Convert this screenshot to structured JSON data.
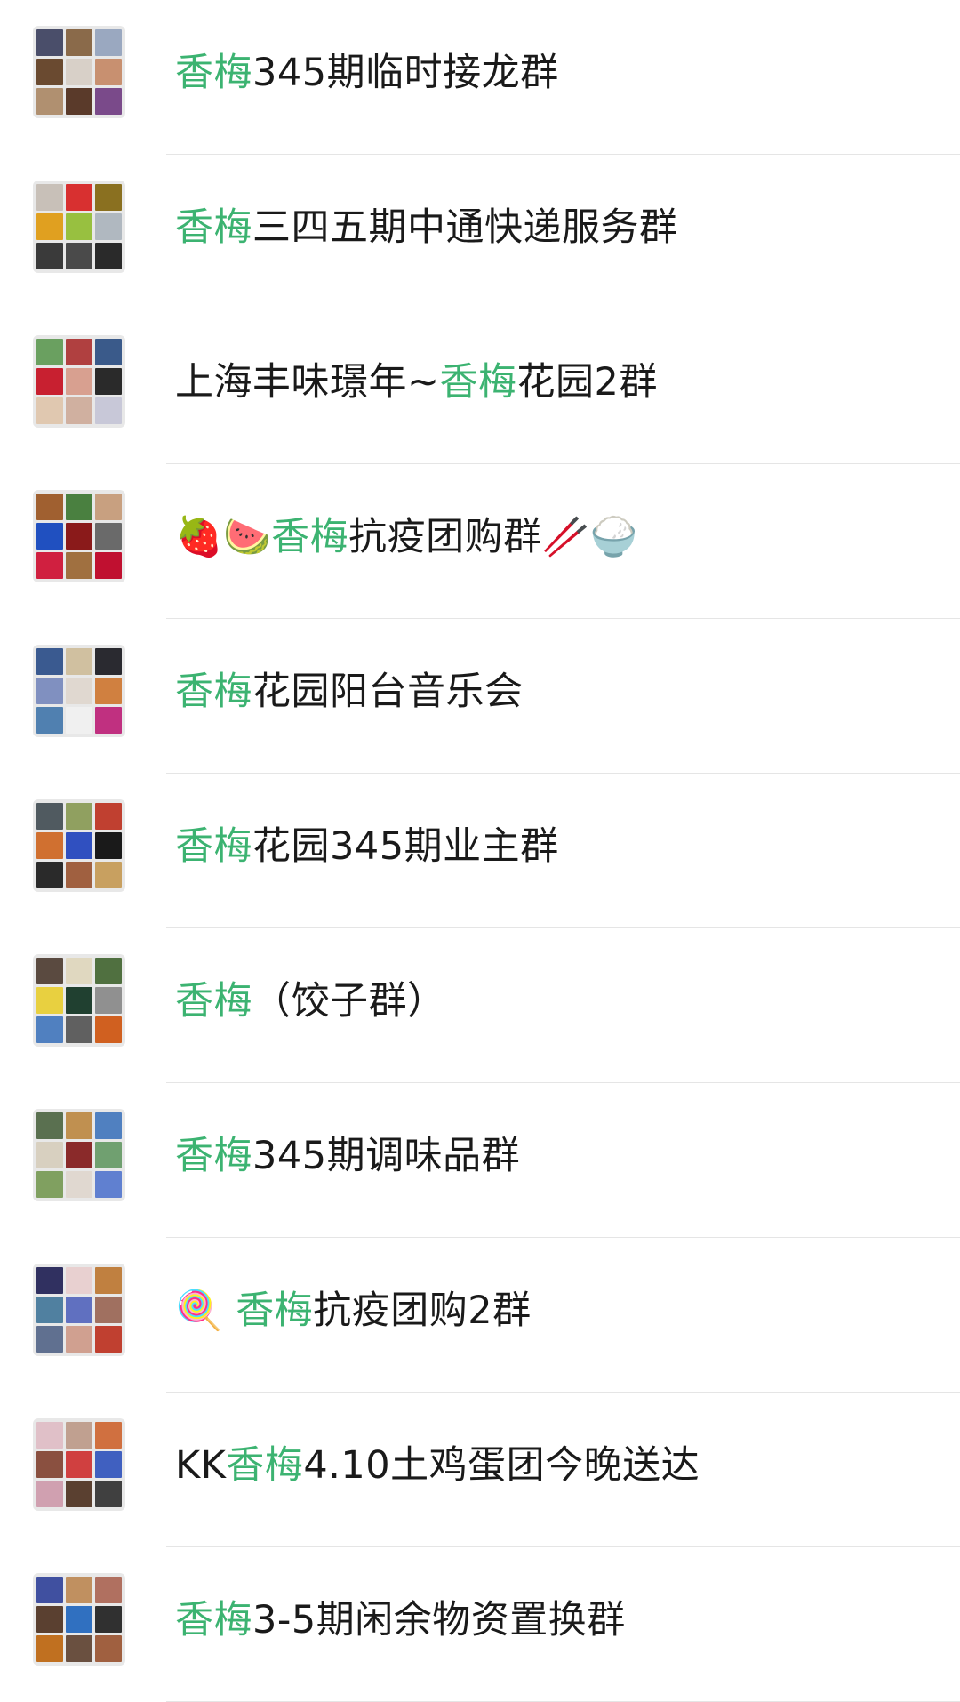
{
  "accent_color": "#3cb371",
  "groups": [
    {
      "parts": [
        {
          "t": "香梅",
          "hl": true
        },
        {
          "t": "345期临时接龙群",
          "hl": false
        }
      ],
      "avatar_colors": [
        "#4a4e6a",
        "#8a6a4a",
        "#9aa8c0",
        "#6a4a30",
        "#d8d0c8",
        "#c89070",
        "#b09070",
        "#5a3a2a",
        "#7a4a8a"
      ]
    },
    {
      "parts": [
        {
          "t": "香梅",
          "hl": true
        },
        {
          "t": "三四五期中通快递服务群",
          "hl": false
        }
      ],
      "avatar_colors": [
        "#c8c0b8",
        "#d83030",
        "#8a7020",
        "#e0a020",
        "#98c040",
        "#b0b8c0",
        "#3a3a3a",
        "#4a4a4a",
        "#2a2a2a"
      ]
    },
    {
      "parts": [
        {
          "t": "上海丰味璟年~",
          "hl": false
        },
        {
          "t": "香梅",
          "hl": true
        },
        {
          "t": "花园2群",
          "hl": false
        }
      ],
      "avatar_colors": [
        "#6aa060",
        "#b04040",
        "#3a5a8a",
        "#c82030",
        "#d8a090",
        "#2a2a2a",
        "#e0c8b0",
        "#d0b0a0",
        "#c8c8d8"
      ]
    },
    {
      "parts": [
        {
          "t": "🍓🍉",
          "hl": false
        },
        {
          "t": "香梅",
          "hl": true
        },
        {
          "t": "抗疫团购群🥢🍚",
          "hl": false
        }
      ],
      "avatar_colors": [
        "#a06030",
        "#4a8040",
        "#c8a080",
        "#2050c0",
        "#8a1a1a",
        "#6a6a6a",
        "#d02040",
        "#a07040",
        "#c01030"
      ]
    },
    {
      "parts": [
        {
          "t": "香梅",
          "hl": true
        },
        {
          "t": "花园阳台音乐会",
          "hl": false
        }
      ],
      "avatar_colors": [
        "#3a5a90",
        "#d0c0a0",
        "#2a2a30",
        "#8090c0",
        "#e0d8d0",
        "#d08040",
        "#5080b0",
        "#f0f0f0",
        "#c03080"
      ]
    },
    {
      "parts": [
        {
          "t": "香梅",
          "hl": true
        },
        {
          "t": "花园345期业主群",
          "hl": false
        }
      ],
      "avatar_colors": [
        "#505a60",
        "#90a060",
        "#c04030",
        "#d07030",
        "#3050c0",
        "#1a1a1a",
        "#2a2a2a",
        "#a06040",
        "#c8a060"
      ]
    },
    {
      "parts": [
        {
          "t": "香梅",
          "hl": true
        },
        {
          "t": "（饺子群）",
          "hl": false
        }
      ],
      "avatar_colors": [
        "#5a4a40",
        "#e0d8c0",
        "#507040",
        "#e8d040",
        "#204030",
        "#909090",
        "#5080c0",
        "#606060",
        "#d06020"
      ]
    },
    {
      "parts": [
        {
          "t": "香梅",
          "hl": true
        },
        {
          "t": "345期调味品群",
          "hl": false
        }
      ],
      "avatar_colors": [
        "#5a7050",
        "#c09050",
        "#5080c0",
        "#d8d0c0",
        "#8a2a2a",
        "#70a070",
        "#80a060",
        "#e0d8d0",
        "#6080d0"
      ]
    },
    {
      "parts": [
        {
          "t": "🍭 ",
          "hl": false
        },
        {
          "t": "香梅",
          "hl": true
        },
        {
          "t": "抗疫团购2群",
          "hl": false
        }
      ],
      "avatar_colors": [
        "#303060",
        "#e8d0d0",
        "#c08040",
        "#5080a0",
        "#6070c0",
        "#a07060",
        "#607090",
        "#d0a090",
        "#c04030"
      ]
    },
    {
      "parts": [
        {
          "t": "KK",
          "hl": false
        },
        {
          "t": "香梅",
          "hl": true
        },
        {
          "t": "4.10土鸡蛋团今晚送达",
          "hl": false
        }
      ],
      "avatar_colors": [
        "#e0c0c8",
        "#c0a090",
        "#d07040",
        "#8a5040",
        "#d04040",
        "#4060c0",
        "#d0a0b0",
        "#5a4030",
        "#404040"
      ]
    },
    {
      "parts": [
        {
          "t": "香梅",
          "hl": true
        },
        {
          "t": "3-5期闲余物资置换群",
          "hl": false
        }
      ],
      "avatar_colors": [
        "#4050a0",
        "#c09060",
        "#b07060",
        "#5a4030",
        "#3070c0",
        "#303030",
        "#c07020",
        "#6a5040",
        "#a06040"
      ]
    }
  ]
}
